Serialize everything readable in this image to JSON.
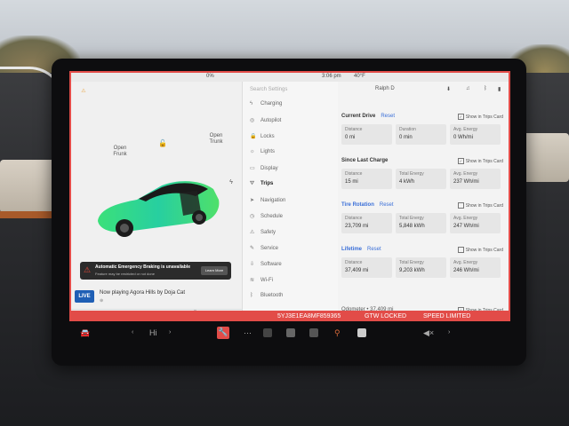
{
  "status": {
    "battery": "0%",
    "time": "3:06 pm",
    "temp": "40°F"
  },
  "car_panel": {
    "open_frunk": "Open Frunk",
    "open_trunk": "Open Trunk",
    "aeb_title": "Automatic Emergency Braking is unavailable",
    "aeb_sub": "Feature may be restricted or not done",
    "aeb_button": "Learn More",
    "media_logo": "LIVE",
    "now_playing": "Now playing Agora Hills by Doja Cat",
    "media_controls": [
      "⏮",
      "■",
      "⏭",
      "☆",
      "⫼",
      "⌕"
    ]
  },
  "menu": {
    "search_placeholder": "Search Settings",
    "items": [
      {
        "label": "Charging",
        "icon": "ϟ"
      },
      {
        "label": "Autopilot",
        "icon": "◎"
      },
      {
        "label": "Locks",
        "icon": "🔒"
      },
      {
        "label": "Lights",
        "icon": "☼"
      },
      {
        "label": "Display",
        "icon": "▭"
      },
      {
        "label": "Trips",
        "icon": "⛛"
      },
      {
        "label": "Navigation",
        "icon": "➤"
      },
      {
        "label": "Schedule",
        "icon": "◷"
      },
      {
        "label": "Safety",
        "icon": "⚠"
      },
      {
        "label": "Service",
        "icon": "✎"
      },
      {
        "label": "Software",
        "icon": "⇩"
      },
      {
        "label": "Wi-Fi",
        "icon": "≋"
      },
      {
        "label": "Bluetooth",
        "icon": "ᛒ"
      }
    ],
    "active_index": 5
  },
  "content": {
    "profile": "Ralph D",
    "sections": [
      {
        "title": "Current Drive",
        "reset": "Reset",
        "show": "Show in Trips Card",
        "checked": true,
        "cells": [
          {
            "k": "Distance",
            "v": "0 mi"
          },
          {
            "k": "Duration",
            "v": "0 min"
          },
          {
            "k": "Avg. Energy",
            "v": "0 Wh/mi"
          }
        ]
      },
      {
        "title": "Since Last Charge",
        "reset": "",
        "show": "Show in Trips Card",
        "checked": true,
        "cells": [
          {
            "k": "Distance",
            "v": "15 mi"
          },
          {
            "k": "Total Energy",
            "v": "4 kWh"
          },
          {
            "k": "Avg. Energy",
            "v": "237 Wh/mi"
          }
        ]
      },
      {
        "title": "Tire Rotation",
        "reset": "Reset",
        "show": "Show in Trips Card",
        "checked": false,
        "cells": [
          {
            "k": "Distance",
            "v": "23,709 mi"
          },
          {
            "k": "Total Energy",
            "v": "5,848 kWh"
          },
          {
            "k": "Avg. Energy",
            "v": "247 Wh/mi"
          }
        ]
      },
      {
        "title": "Lifetime",
        "reset": "Reset",
        "show": "Show in Trips Card",
        "checked": false,
        "cells": [
          {
            "k": "Distance",
            "v": "37,409 mi"
          },
          {
            "k": "Total Energy",
            "v": "9,203 kWh"
          },
          {
            "k": "Avg. Energy",
            "v": "246 Wh/mi"
          }
        ]
      }
    ],
    "odometer": "Odometer • 37,409 mi",
    "trip_card_2": "Show in Trips Card"
  },
  "banner": {
    "vin": "5YJ3E1EA8MF859365",
    "locked": "GTW LOCKED",
    "speed": "SPEED LIMITED"
  },
  "dock": {
    "hi_label": "Hi",
    "volume": "◀×"
  },
  "colors": {
    "accent_red": "#e24c48",
    "link_blue": "#3a6fd8",
    "car_green": "#2fd88a"
  }
}
